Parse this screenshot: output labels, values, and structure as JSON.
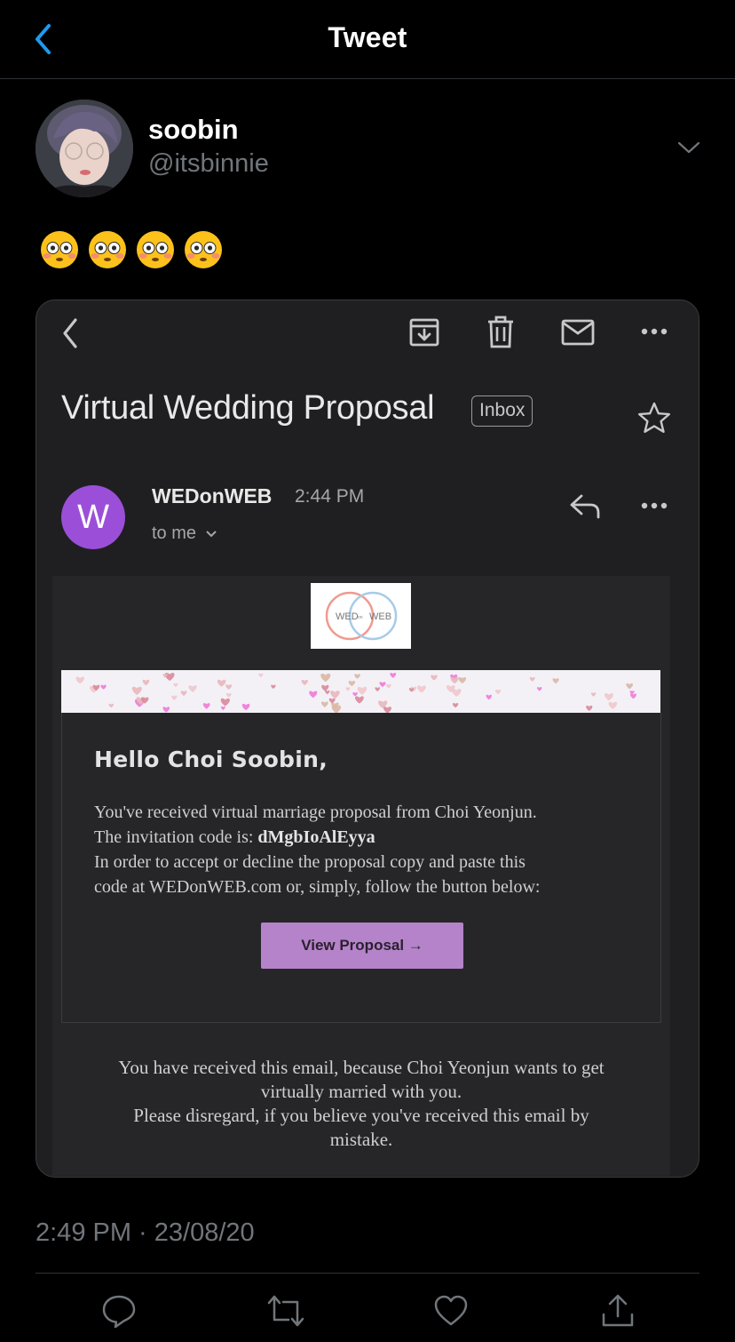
{
  "header": {
    "title": "Tweet"
  },
  "tweet": {
    "display_name": "soobin",
    "handle": "@itsbinnie",
    "emoji_text": "😳😳😳😳",
    "timestamp": "2:49 PM · 23/08/20"
  },
  "email": {
    "subject": "Virtual Wedding Proposal",
    "label": "Inbox",
    "sender_initial": "W",
    "sender": "WEDonWEB",
    "time": "2:44 PM",
    "recipient": "to me",
    "logo_left": "WED",
    "logo_mid": "on",
    "logo_right": "WEB",
    "greeting": "Hello Choi Soobin,",
    "line1": "You've received virtual marriage proposal from Choi Yeonjun.",
    "code_label": "The invitation code is: ",
    "code": "dMgbIoAlEyya",
    "line3": "In order to accept or decline the proposal copy and paste this",
    "line4": "code at WEDonWEB.com or, simply, follow the button below:",
    "button_label": "View Proposal →",
    "footer_1": "You have received this email, because Choi Yeonjun wants to get",
    "footer_2": "virtually married with you.",
    "footer_3": "Please disregard, if you believe you've received this email by",
    "footer_4": "mistake."
  },
  "colors": {
    "background": "#000000",
    "accent": "#1d9bf0",
    "secondary_text": "#71767b",
    "sender_avatar": "#9b4fd8",
    "button": "#b583c9"
  },
  "icons": {
    "back": "chevron-left-icon",
    "more": "chevron-down-icon",
    "actions": [
      "reply-icon",
      "retweet-icon",
      "like-icon",
      "share-icon"
    ],
    "gmail_toolbar": [
      "chevron-left-icon",
      "archive-icon",
      "trash-icon",
      "mail-icon",
      "more-icon"
    ]
  }
}
